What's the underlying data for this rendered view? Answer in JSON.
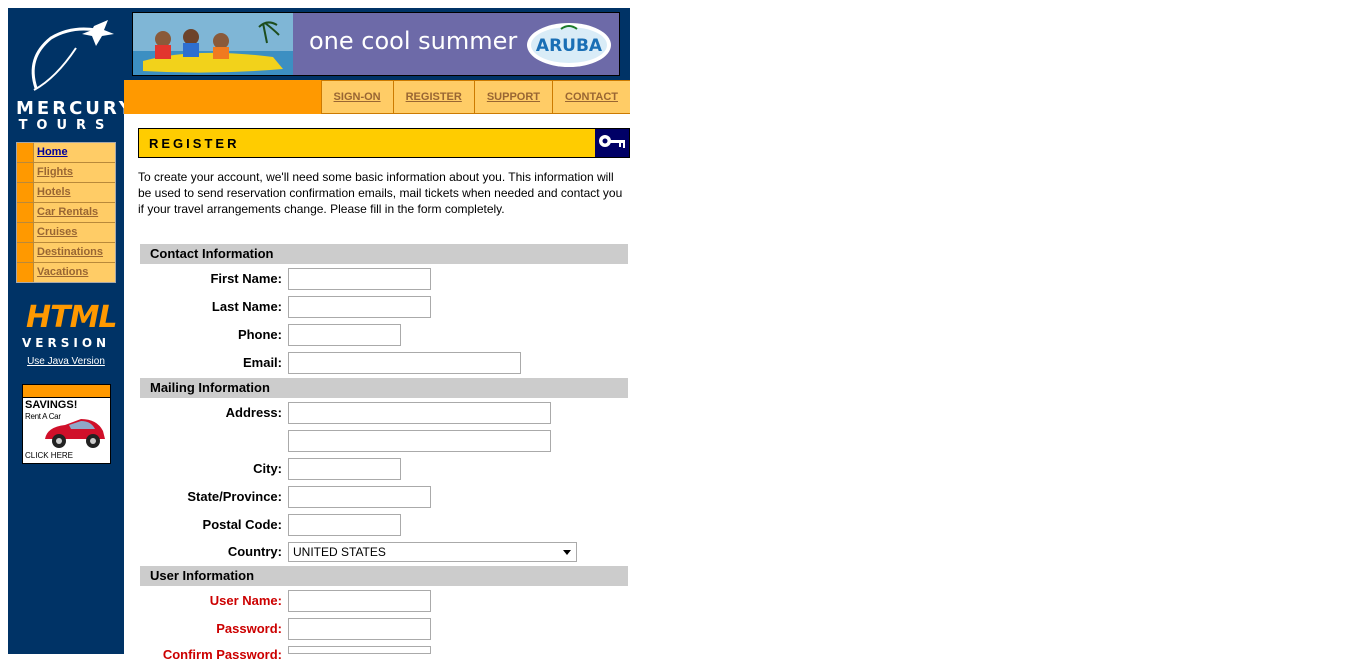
{
  "logo": {
    "line1": "MERCURY",
    "line2": "TOURS",
    "icon": "plane-icon"
  },
  "sidebar": {
    "menu": [
      {
        "label": "Home"
      },
      {
        "label": "Flights"
      },
      {
        "label": "Hotels"
      },
      {
        "label": "Car Rentals"
      },
      {
        "label": "Cruises"
      },
      {
        "label": "Destinations"
      },
      {
        "label": "Vacations"
      }
    ],
    "html_badge": {
      "word1": "HTML",
      "word2": "VERSION"
    },
    "java_link": "Use Java Version",
    "ad": {
      "savings": "SAVINGS!",
      "rent": "Rent A Car",
      "click": "CLICK HERE"
    }
  },
  "banner": {
    "tagline": "one cool summer",
    "brand": "ARUBA"
  },
  "topnav": [
    "SIGN-ON",
    "REGISTER",
    "SUPPORT",
    "CONTACT"
  ],
  "register": {
    "title": "REGISTER",
    "intro": "To create your account, we'll need some basic information about you. This information will be used to send reservation confirmation emails, mail tickets when needed and contact you if your travel arrangements change. Please fill in the form completely."
  },
  "form": {
    "contact": {
      "heading": "Contact Information",
      "first_name": "First Name:",
      "last_name": "Last Name:",
      "phone": "Phone:",
      "email": "Email:"
    },
    "mailing": {
      "heading": "Mailing Information",
      "address": "Address:",
      "city": "City:",
      "state": "State/Province:",
      "postal": "Postal Code:",
      "country": "Country:",
      "country_value": "UNITED STATES"
    },
    "user": {
      "heading": "User Information",
      "username": "User Name:",
      "password": "Password:",
      "confirm": "Confirm Password:"
    }
  },
  "colors": {
    "navy": "#003366",
    "orange": "#ff9900",
    "gold": "#ffcc00",
    "required": "#cc0000"
  }
}
